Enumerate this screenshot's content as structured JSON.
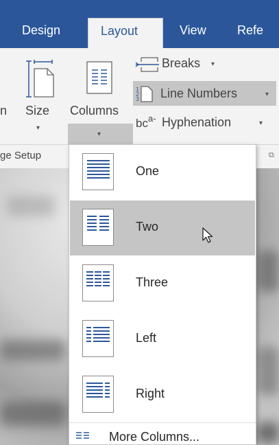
{
  "ribbon_tabs": [
    "Design",
    "Layout",
    "View",
    "Refe"
  ],
  "ribbon": {
    "size_label": "Size",
    "columns_label": "Columns",
    "left_cut_label": "n",
    "breaks_label": "Breaks",
    "line_numbers_label": "Line Numbers",
    "hyphenation_label": "Hyphenation",
    "hyphenation_icon_text": "bc",
    "hyphenation_icon_sup": "a-",
    "group_label": "ge Setup",
    "caret": "▾"
  },
  "columns_menu": {
    "items": [
      {
        "label": "One",
        "icon": "one-column-icon",
        "hovered": false
      },
      {
        "label": "Two",
        "icon": "two-columns-icon",
        "hovered": true
      },
      {
        "label": "Three",
        "icon": "three-columns-icon",
        "hovered": false
      },
      {
        "label": "Left",
        "icon": "left-column-icon",
        "hovered": false
      },
      {
        "label": "Right",
        "icon": "right-column-icon",
        "hovered": false
      }
    ],
    "more": "More Columns..."
  },
  "colors": {
    "tab_bar": "#2b579a",
    "ribbon_bg": "#f3f3f3",
    "hover": "#c5c5c5",
    "icon_line": "#2b579a"
  }
}
